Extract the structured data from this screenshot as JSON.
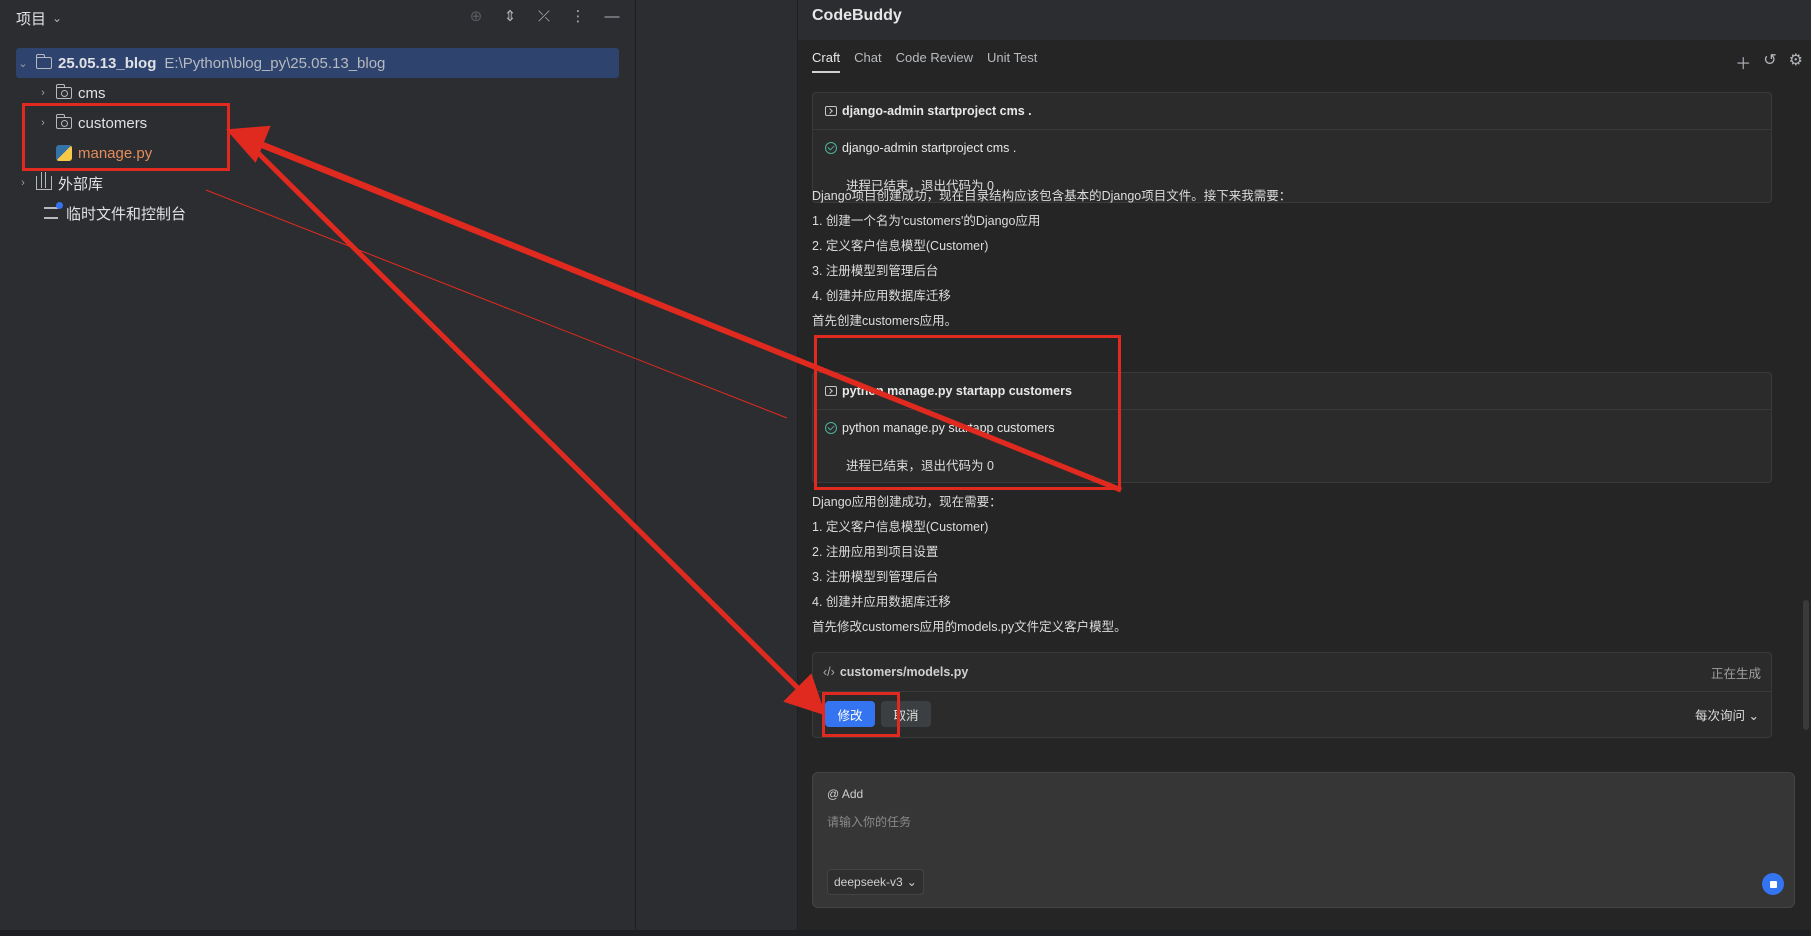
{
  "left": {
    "header_title": "项目",
    "tree": [
      {
        "label": "25.05.13_blog",
        "path": "E:\\Python\\blog_py\\25.05.13_blog"
      },
      {
        "label": "cms"
      },
      {
        "label": "customers"
      },
      {
        "label": "manage.py"
      },
      {
        "label": "外部库"
      },
      {
        "label": "临时文件和控制台"
      }
    ]
  },
  "right": {
    "title": "CodeBuddy",
    "tabs": [
      "Craft",
      "Chat",
      "Code Review",
      "Unit Test"
    ],
    "card1": {
      "cmd": "django-admin startproject cms .",
      "done": "django-admin startproject cms .",
      "output": "进程已结束，退出代码为 0"
    },
    "msg1": [
      "Django项目创建成功，现在目录结构应该包含基本的Django项目文件。接下来我需要：",
      "1. 创建一个名为'customers'的Django应用",
      "2. 定义客户信息模型(Customer)",
      "3. 注册模型到管理后台",
      "4. 创建并应用数据库迁移",
      "首先创建customers应用。"
    ],
    "card2": {
      "cmd": "python manage.py startapp customers",
      "done": "python manage.py startapp customers",
      "output": "进程已结束，退出代码为 0"
    },
    "msg2": [
      "Django应用创建成功，现在需要：",
      "1. 定义客户信息模型(Customer)",
      "2. 注册应用到项目设置",
      "3. 注册模型到管理后台",
      "4. 创建并应用数据库迁移",
      "首先修改customers应用的models.py文件定义客户模型。"
    ],
    "code": {
      "file": "customers/models.py",
      "status": "正在生成",
      "modify": "修改",
      "cancel": "取消",
      "ask_mode": "每次询问"
    },
    "input": {
      "add": "@ Add",
      "placeholder": "请输入你的任务",
      "model": "deepseek-v3"
    }
  },
  "colors": {
    "accent": "#3574f0",
    "annotation": "#e12a1f",
    "selected_row": "#2e436e"
  }
}
